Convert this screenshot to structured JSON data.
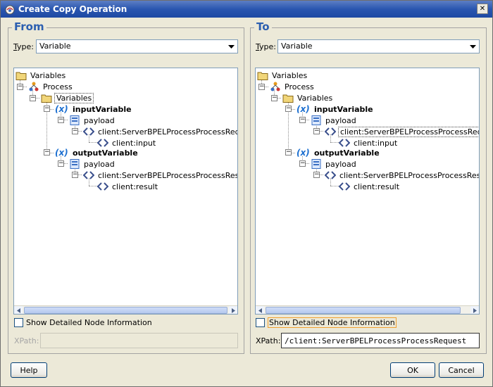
{
  "window": {
    "title": "Create Copy Operation",
    "close_glyph": "✕"
  },
  "from": {
    "legend": "From",
    "type_label": "Type:",
    "type_value": "Variable",
    "tree": [
      {
        "label": "Variables",
        "icon": "folder-icon"
      },
      {
        "label": "Process",
        "icon": "process-icon"
      },
      {
        "label": "Variables",
        "icon": "folder-icon"
      },
      {
        "label": "inputVariable",
        "icon": "variable-icon"
      },
      {
        "label": "payload",
        "icon": "message-part-icon"
      },
      {
        "label": "client:ServerBPELProcessProcessRequest",
        "icon": "element-icon"
      },
      {
        "label": "client:input",
        "icon": "element-icon"
      },
      {
        "label": "outputVariable",
        "icon": "variable-icon"
      },
      {
        "label": "payload",
        "icon": "message-part-icon"
      },
      {
        "label": "client:ServerBPELProcessProcessResponse",
        "icon": "element-icon"
      },
      {
        "label": "client:result",
        "icon": "element-icon"
      }
    ],
    "show_detailed_label": "Show Detailed Node Information",
    "xpath_label": "XPath:",
    "xpath_value": ""
  },
  "to": {
    "legend": "To",
    "type_label": "Type:",
    "type_value": "Variable",
    "tree": [
      {
        "label": "Variables",
        "icon": "folder-icon"
      },
      {
        "label": "Process",
        "icon": "process-icon"
      },
      {
        "label": "Variables",
        "icon": "folder-icon"
      },
      {
        "label": "inputVariable",
        "icon": "variable-icon"
      },
      {
        "label": "payload",
        "icon": "message-part-icon"
      },
      {
        "label": "client:ServerBPELProcessProcessRequest",
        "icon": "element-icon"
      },
      {
        "label": "client:input",
        "icon": "element-icon"
      },
      {
        "label": "outputVariable",
        "icon": "variable-icon"
      },
      {
        "label": "payload",
        "icon": "message-part-icon"
      },
      {
        "label": "client:ServerBPELProcessProcessResponse",
        "icon": "element-icon"
      },
      {
        "label": "client:result",
        "icon": "element-icon"
      }
    ],
    "show_detailed_label": "Show Detailed Node Information",
    "xpath_label": "XPath:",
    "xpath_value": "/client:ServerBPELProcessProcessRequest"
  },
  "buttons": {
    "help": "Help",
    "ok": "OK",
    "cancel": "Cancel"
  }
}
